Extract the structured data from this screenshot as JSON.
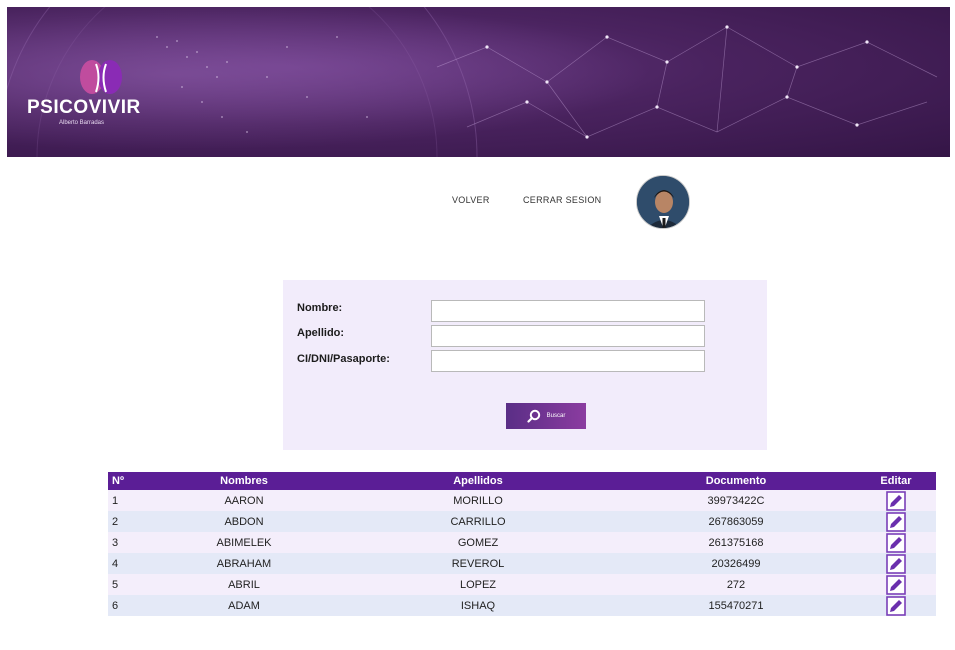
{
  "brand": {
    "name": "PSICOVIVIR",
    "tagline": "Alberto Barradas",
    "colors": {
      "primary": "#5b1e96",
      "banner": "#4a235f",
      "accent": "#c04c9e"
    }
  },
  "nav": {
    "volver": "VOLVER",
    "cerrar_sesion": "CERRAR SESION"
  },
  "search": {
    "nombre_label": "Nombre:",
    "apellido_label": "Apellido:",
    "documento_label": "CI/DNI/Pasaporte:",
    "nombre_value": "",
    "apellido_value": "",
    "documento_value": "",
    "button_label": "Buscar",
    "button_icon": "search-icon"
  },
  "table": {
    "headers": {
      "num": "Nº",
      "nombres": "Nombres",
      "apellidos": "Apellidos",
      "documento": "Documento",
      "editar": "Editar"
    },
    "rows": [
      {
        "num": "1",
        "nombres": "AARON",
        "apellidos": "MORILLO",
        "documento": "39973422C"
      },
      {
        "num": "2",
        "nombres": "ABDON",
        "apellidos": "CARRILLO",
        "documento": "267863059"
      },
      {
        "num": "3",
        "nombres": "ABIMELEK",
        "apellidos": "GOMEZ",
        "documento": "261375168"
      },
      {
        "num": "4",
        "nombres": "ABRAHAM",
        "apellidos": "REVEROL",
        "documento": "20326499"
      },
      {
        "num": "5",
        "nombres": "ABRIL",
        "apellidos": "LOPEZ",
        "documento": "272"
      },
      {
        "num": "6",
        "nombres": "ADAM",
        "apellidos": "ISHAQ",
        "documento": "155470271"
      }
    ],
    "edit_icon": "edit-pencil-icon"
  }
}
